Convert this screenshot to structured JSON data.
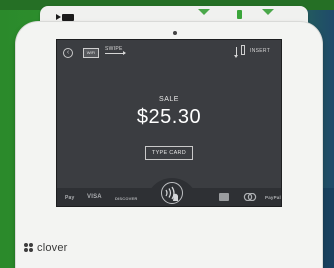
{
  "screen": {
    "swipe_box_text": "WIFI",
    "swipe_label": "SWIPE",
    "insert_label": "INSERT",
    "sale_label": "SALE",
    "amount": "$25.30",
    "type_card_label": "TYPE CARD"
  },
  "payment_logos": {
    "apple_pay": "Pay",
    "visa": "VISA",
    "discover": "DISCOVER",
    "paypal": "PayPal"
  },
  "brand": {
    "name": "clover"
  }
}
